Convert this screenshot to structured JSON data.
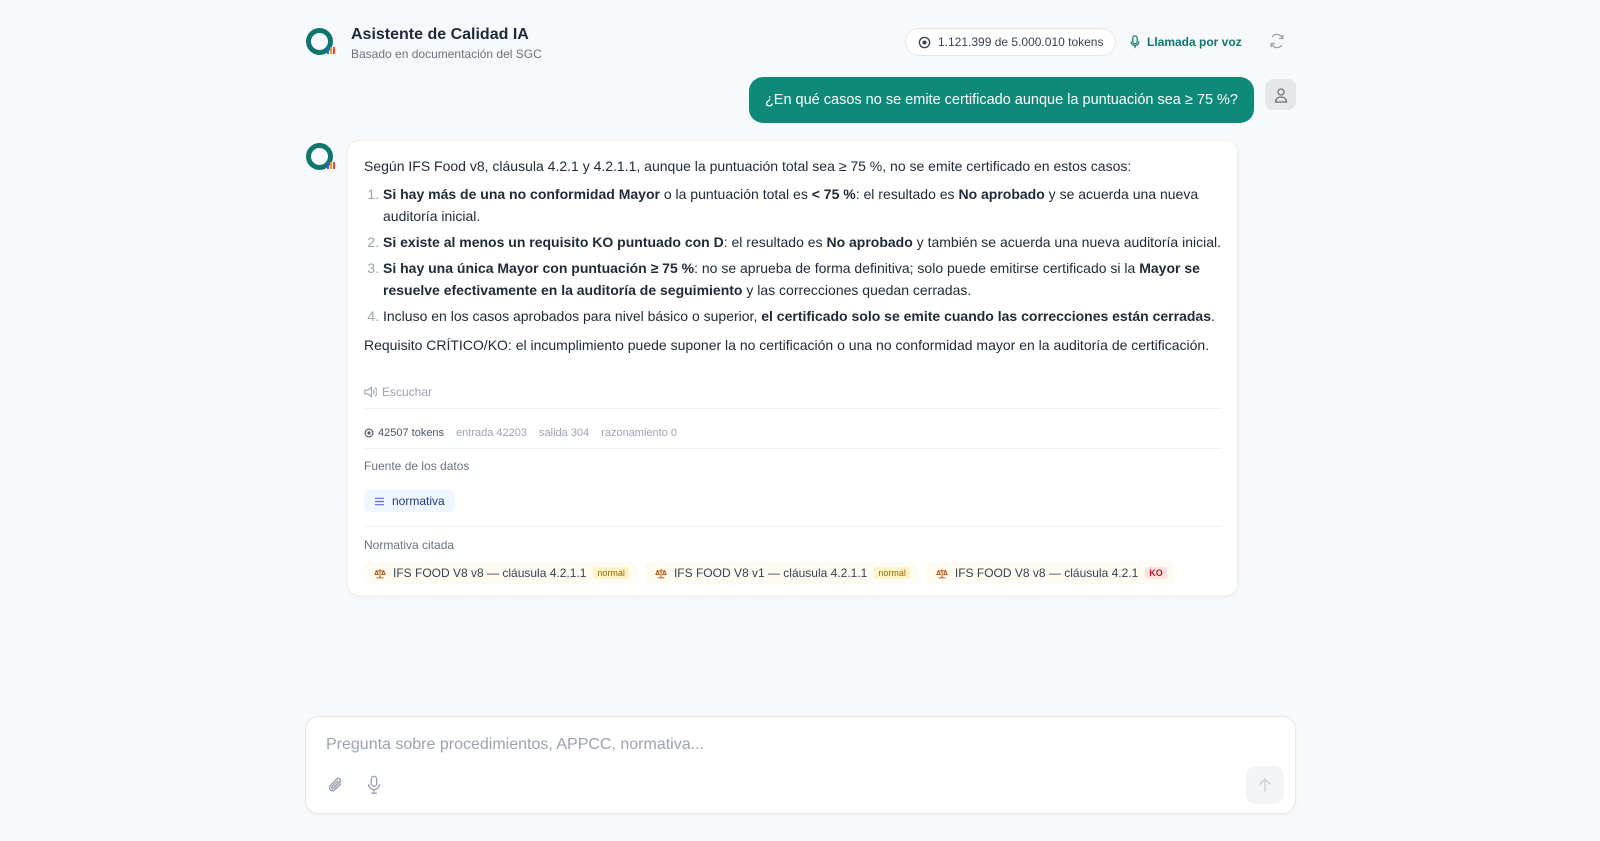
{
  "header": {
    "title": "Asistente de Calidad IA",
    "subtitle": "Basado en documentación del SGC",
    "tokens": "1.121.399 de 5.000.010 tokens",
    "voice_label": "Llamada por voz"
  },
  "colors": {
    "accent": "#0f8a7a",
    "logo_ring": "#0f766e",
    "logo_bars": [
      "#2563eb",
      "#f59e0b",
      "#ef4444"
    ]
  },
  "user_message": "¿En qué casos no se emite certificado aunque la puntuación sea ≥ 75 %?",
  "answer": {
    "intro": "Según IFS Food v8, cláusula 4.2.1 y 4.2.1.1, aunque la puntuación total sea ≥ 75 %, no se emite certificado en estos casos:",
    "items": [
      {
        "b1": "Si hay más de una no conformidad Mayor",
        "t1": " o la puntuación total es ",
        "b2": "< 75 %",
        "t2": ": el resultado es ",
        "b3": "No aprobado",
        "t3": " y se acuerda una nueva auditoría inicial."
      },
      {
        "b1": "Si existe al menos un requisito KO puntuado con D",
        "t1": ": el resultado es ",
        "b2": "No aprobado",
        "t2": " y también se acuerda una nueva auditoría inicial."
      },
      {
        "b1": "Si hay una única Mayor con puntuación ≥ 75 %",
        "t1": ": no se aprueba de forma definitiva; solo puede emitirse certificado si la ",
        "b2": "Mayor se resuelve efectivamente en la auditoría de seguimiento",
        "t2": " y las correcciones quedan cerradas."
      },
      {
        "t1": "Incluso en los casos aprobados para nivel básico o superior, ",
        "b1": "el certificado solo se emite cuando las correcciones están cerradas",
        "t2": "."
      }
    ],
    "critical_note": "Requisito CRÍTICO/KO: el incumplimiento puede suponer la no certificación o una no conformidad mayor en la auditoría de certificación.",
    "listen_label": "Escuchar",
    "usage": {
      "total": "42507 tokens",
      "input": "entrada 42203",
      "output": "salida 304",
      "reasoning": "razonamiento 0"
    },
    "source_label": "Fuente de los datos",
    "source_chip": "normativa",
    "refs_label": "Normativa citada",
    "refs": [
      {
        "label": "IFS FOOD V8 v8 — cláusula 4.2.1.1",
        "badge": "normal"
      },
      {
        "label": "IFS FOOD V8 v1 — cláusula 4.2.1.1",
        "badge": "normal"
      },
      {
        "label": "IFS FOOD V8 v8 — cláusula 4.2.1",
        "badge": "KO"
      }
    ]
  },
  "composer": {
    "placeholder": "Pregunta sobre procedimientos, APPCC, normativa..."
  }
}
